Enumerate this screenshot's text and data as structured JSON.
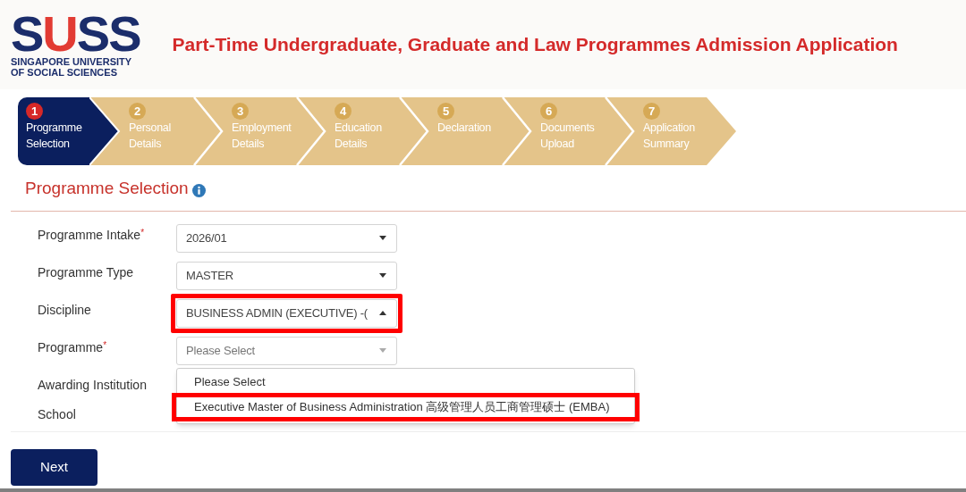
{
  "header": {
    "logo": {
      "letters": "SUSS",
      "subtitle_lines": [
        "SINGAPORE UNIVERSITY",
        "OF SOCIAL SCIENCES"
      ]
    },
    "title": "Part-Time Undergraduate, Graduate and Law Programmes Admission Application"
  },
  "steps": [
    {
      "number": "1",
      "lines": [
        "Programme",
        "Selection"
      ],
      "selected": true
    },
    {
      "number": "2",
      "lines": [
        "Personal",
        "Details"
      ],
      "selected": false
    },
    {
      "number": "3",
      "lines": [
        "Employment",
        "Details"
      ],
      "selected": false
    },
    {
      "number": "4",
      "lines": [
        "Education",
        "Details"
      ],
      "selected": false
    },
    {
      "number": "5",
      "lines": [
        "Declaration"
      ],
      "selected": false
    },
    {
      "number": "6",
      "lines": [
        "Documents",
        "Upload"
      ],
      "selected": false
    },
    {
      "number": "7",
      "lines": [
        "Application",
        "Summary"
      ],
      "selected": false
    }
  ],
  "section": {
    "title": "Programme Selection"
  },
  "fields": [
    {
      "label": "Programme Intake",
      "required_mark": "*",
      "kind": "select",
      "value": "2026/01",
      "expanded": false,
      "highlighted": false
    },
    {
      "label": "Programme Type",
      "kind": "select",
      "value": "MASTER",
      "expanded": false,
      "highlighted": false
    },
    {
      "label": "Discipline",
      "kind": "select",
      "value": "BUSINESS ADMIN (EXECUTIVE) -(",
      "expanded": true,
      "highlighted": true
    },
    {
      "label": "Programme",
      "required_mark": "*",
      "kind": "select",
      "placeholder": "Please Select",
      "expanded": false,
      "highlighted": false,
      "options": [
        {
          "label": "Please Select",
          "highlighted": false
        },
        {
          "label": "Executive Master of Business Administration 高级管理人员工商管理硕士 (EMBA)",
          "highlighted": true
        }
      ]
    },
    {
      "label": "Awarding Institution",
      "kind": "text"
    },
    {
      "label": "School",
      "kind": "text"
    }
  ],
  "buttons": [
    {
      "label": "Next"
    }
  ]
}
